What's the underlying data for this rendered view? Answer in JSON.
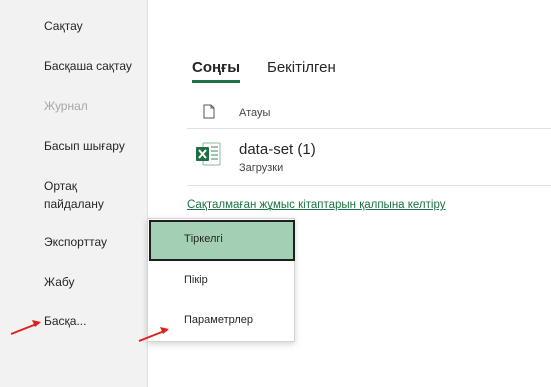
{
  "sidebar": {
    "items": [
      {
        "label": "Сақтау"
      },
      {
        "label": "Басқаша сақтау"
      },
      {
        "label": "Журнал"
      },
      {
        "label": "Басып шығару"
      },
      {
        "label": "Ортақ пайдалану"
      },
      {
        "label": "Экспорттау"
      },
      {
        "label": "Жабу"
      },
      {
        "label": "Басқа..."
      }
    ]
  },
  "main": {
    "tabs": [
      {
        "label": "Соңғы",
        "active": true
      },
      {
        "label": "Бекітілген",
        "active": false
      }
    ],
    "column_name": "Атауы",
    "files": [
      {
        "name": "data-set (1)",
        "location": "Загрузки",
        "icon": "excel-icon"
      }
    ],
    "recover_link": "Сақталмаған жұмыс кітаптарын қалпына келтіру"
  },
  "popup_menu": {
    "items": [
      {
        "label": "Тіркелгі",
        "selected": true
      },
      {
        "label": "Пікір",
        "selected": false
      },
      {
        "label": "Параметрлер",
        "selected": false
      }
    ]
  },
  "colors": {
    "accent": "#217346",
    "selected_bg": "#a3cfb4",
    "link": "#1a7340",
    "annotation_arrow": "#e0201b"
  }
}
